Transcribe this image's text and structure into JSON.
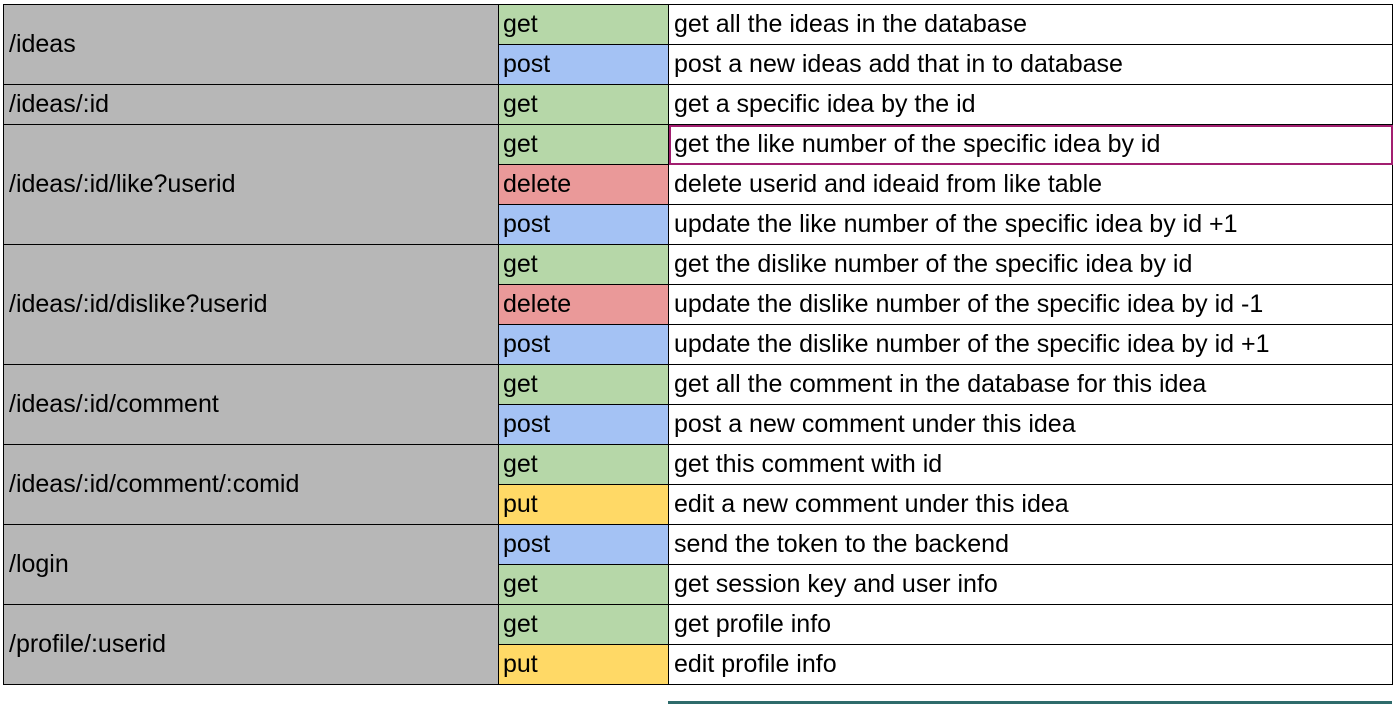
{
  "routes": [
    {
      "path": "/ideas",
      "rows": [
        {
          "method": "get",
          "desc": "get all the ideas in the database"
        },
        {
          "method": "post",
          "desc": "post a new ideas add that in to database"
        }
      ]
    },
    {
      "path": "/ideas/:id",
      "rows": [
        {
          "method": "get",
          "desc": "get a specific idea by the id"
        }
      ]
    },
    {
      "path": "/ideas/:id/like?userid",
      "rows": [
        {
          "method": "get",
          "desc": "get the like number of the specific idea by id",
          "selected": true
        },
        {
          "method": "delete",
          "desc": "delete userid and ideaid from like table"
        },
        {
          "method": "post",
          "desc": "update the like number of the specific idea by id +1"
        }
      ]
    },
    {
      "path": "/ideas/:id/dislike?userid",
      "rows": [
        {
          "method": "get",
          "desc": "get the dislike number of the specific idea by id"
        },
        {
          "method": "delete",
          "desc": "update the dislike number of the specific idea by id -1"
        },
        {
          "method": "post",
          "desc": "update the dislike number of the specific idea by id +1"
        }
      ]
    },
    {
      "path": "/ideas/:id/comment",
      "rows": [
        {
          "method": "get",
          "desc": "get all the comment in the database for this idea"
        },
        {
          "method": "post",
          "desc": "post a new comment under this idea"
        }
      ]
    },
    {
      "path": "/ideas/:id/comment/:comid",
      "rows": [
        {
          "method": "get",
          "desc": "get this comment with id"
        },
        {
          "method": "put",
          "desc": "edit a new comment under this idea"
        }
      ]
    },
    {
      "path": "/login",
      "rows": [
        {
          "method": "post",
          "desc": "send the token to the backend"
        },
        {
          "method": "get",
          "desc": "get session key and user info"
        }
      ]
    },
    {
      "path": "/profile/:userid",
      "rows": [
        {
          "method": "get",
          "desc": "get profile info"
        },
        {
          "method": "put",
          "desc": "edit profile info"
        }
      ]
    }
  ],
  "colors": {
    "route_bg": "#b7b7b7",
    "get": "#b6d7a8",
    "post": "#a4c2f4",
    "delete": "#ea9999",
    "put": "#ffd966",
    "selection": "#a21f70"
  }
}
